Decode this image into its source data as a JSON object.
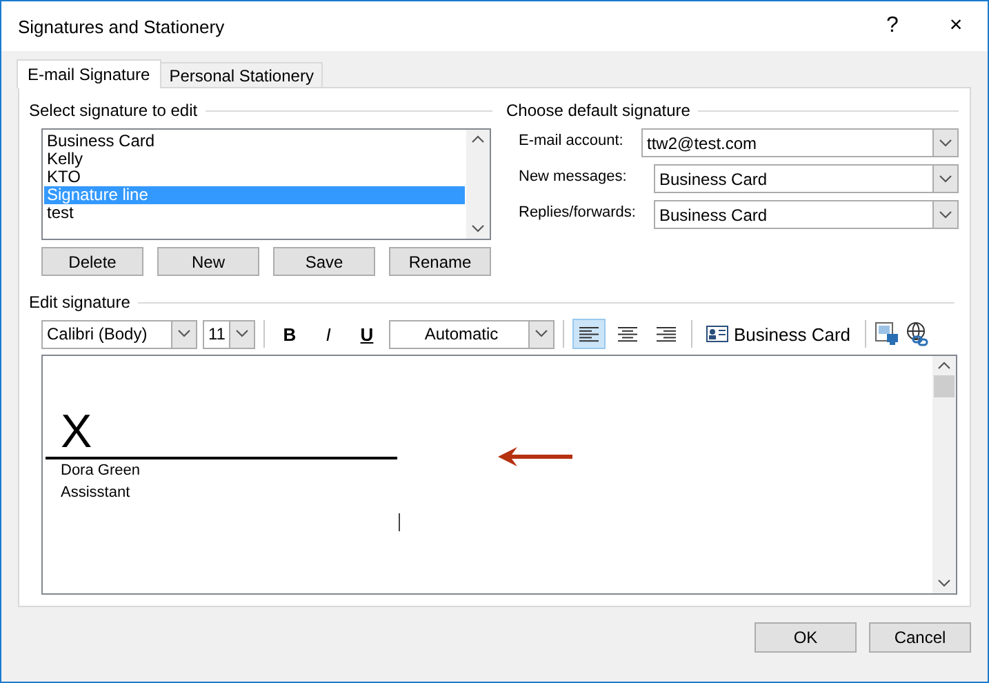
{
  "window": {
    "title": "Signatures and Stationery",
    "help": "?",
    "close": "×"
  },
  "tabs": [
    {
      "label": "E-mail Signature",
      "selected": true
    },
    {
      "label": "Personal Stationery",
      "selected": false
    }
  ],
  "select_signature": {
    "label": "Select signature to edit",
    "items": [
      {
        "label": "Business Card",
        "selected": false
      },
      {
        "label": "Kelly",
        "selected": false
      },
      {
        "label": "KTO",
        "selected": false
      },
      {
        "label": "Signature line",
        "selected": true
      },
      {
        "label": "test",
        "selected": false
      }
    ],
    "buttons": [
      "Delete",
      "New",
      "Save",
      "Rename"
    ]
  },
  "default_signature": {
    "label": "Choose default signature",
    "fields": [
      {
        "label": "E-mail account:",
        "value": "ttw2@test.com"
      },
      {
        "label": "New messages:",
        "value": "Business Card"
      },
      {
        "label": "Replies/forwards:",
        "value": "Business Card"
      }
    ]
  },
  "edit_signature": {
    "label": "Edit signature",
    "font": "Calibri (Body)",
    "size": "11",
    "format_buttons": [
      "B",
      "I",
      "U"
    ],
    "font_color": "Automatic",
    "alignment": [
      {
        "kind": "left",
        "selected": true
      },
      {
        "kind": "center",
        "selected": false
      },
      {
        "kind": "right",
        "selected": false
      }
    ],
    "business_card": "Business Card",
    "content": {
      "mark": "X",
      "lines": [
        "Dora Green",
        "Assisstant"
      ]
    }
  },
  "buttons": [
    "OK",
    "Cancel"
  ]
}
